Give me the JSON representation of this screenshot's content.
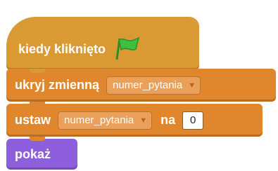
{
  "blocks": {
    "hat": {
      "label": "kiedy kliknięto",
      "icon": "green-flag-icon",
      "color": "#d99a34"
    },
    "hide_variable": {
      "label": "ukryj zmienną",
      "variable": "numer_pytania",
      "color": "#e0872d"
    },
    "set_variable": {
      "label": "ustaw",
      "variable": "numer_pytania",
      "connector": "na",
      "value": "0",
      "color": "#e0872d"
    },
    "show": {
      "label": "pokaż",
      "color": "#8e5fdc"
    }
  },
  "icons": {
    "dropdown_arrow": "▼"
  },
  "colors": {
    "flag": "#3fbf3f",
    "flag_dark": "#2a8f2a"
  }
}
